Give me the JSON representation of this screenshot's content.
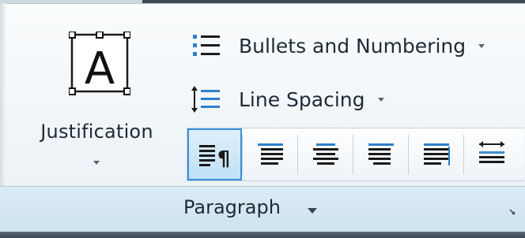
{
  "ribbon": {
    "justification": {
      "label": "Justification",
      "icon": "text-frame-a-icon",
      "glyph": "A"
    },
    "bullets": {
      "label": "Bullets and Numbering",
      "icon": "bulleted-list-icon"
    },
    "line_spacing": {
      "label": "Line Spacing",
      "icon": "line-spacing-icon"
    },
    "alignment_buttons": [
      {
        "name": "paragraph-settings",
        "icon": "paragraph-mark-icon",
        "glyph": "¶",
        "selected": true
      },
      {
        "name": "align-left",
        "icon": "align-left-icon",
        "selected": false
      },
      {
        "name": "align-center",
        "icon": "align-center-icon",
        "selected": false
      },
      {
        "name": "align-right",
        "icon": "align-right-icon",
        "selected": false
      },
      {
        "name": "justify",
        "icon": "justify-icon",
        "selected": false
      },
      {
        "name": "distribute",
        "icon": "distribute-icon",
        "selected": false
      }
    ],
    "panel": {
      "label": "Paragraph",
      "launcher_icon": "dialog-launcher-icon"
    }
  },
  "colors": {
    "accent": "#3b8ede",
    "text": "#1f2a36",
    "footer_bg": "#cde3ee",
    "icon_blue": "#2f7fc8"
  }
}
